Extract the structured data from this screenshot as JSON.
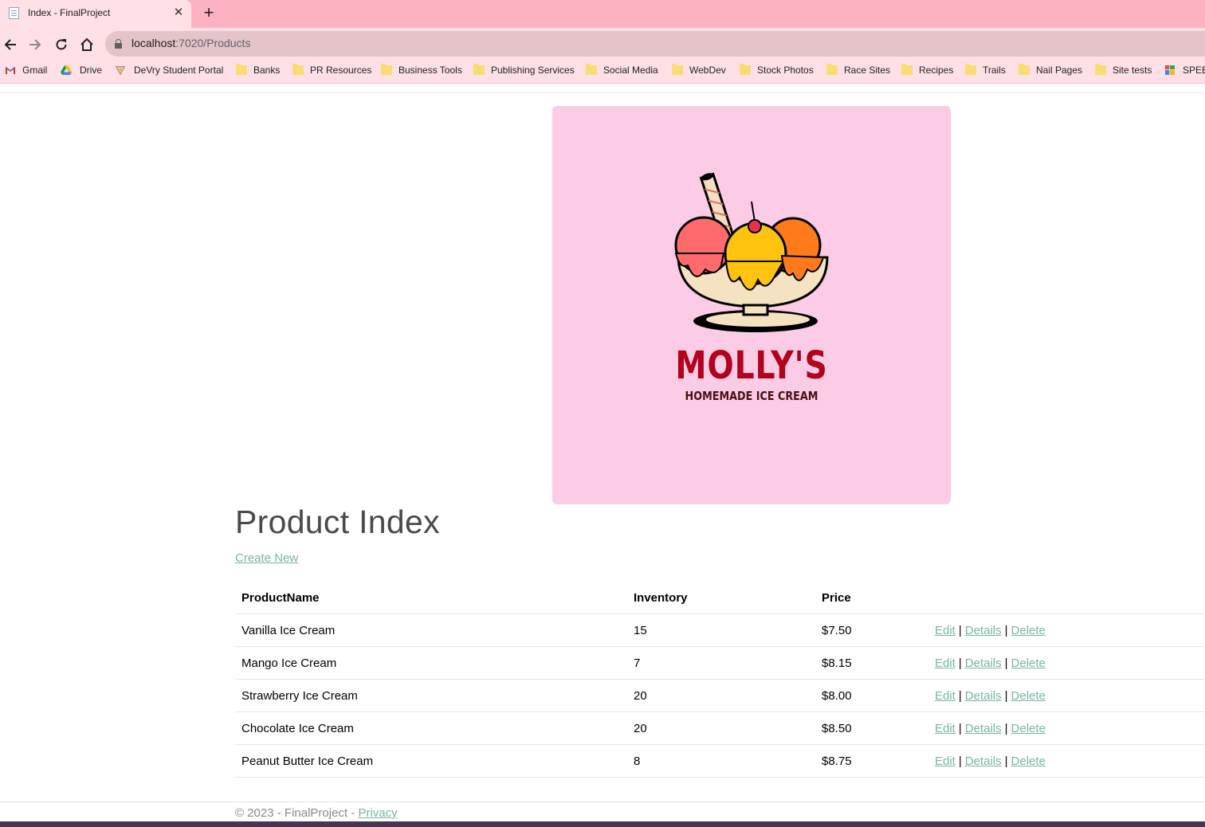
{
  "browser": {
    "tab_title": "Index - FinalProject",
    "tab_close": "✕",
    "new_tab": "+",
    "url_host": "localhost",
    "url_path": ":7020/Products",
    "bookmarks": [
      {
        "label": "Gmail",
        "icon": "gmail-icon"
      },
      {
        "label": "Drive",
        "icon": "drive-icon"
      },
      {
        "label": "DeVry Student Portal",
        "icon": "devry-icon"
      },
      {
        "label": "Banks",
        "icon": "folder-icon"
      },
      {
        "label": "PR Resources",
        "icon": "folder-icon"
      },
      {
        "label": "Business Tools",
        "icon": "folder-icon"
      },
      {
        "label": "Publishing Services",
        "icon": "folder-icon"
      },
      {
        "label": "Social Media",
        "icon": "folder-icon"
      },
      {
        "label": "WebDev",
        "icon": "folder-icon"
      },
      {
        "label": "Stock Photos",
        "icon": "folder-icon"
      },
      {
        "label": "Race Sites",
        "icon": "folder-icon"
      },
      {
        "label": "Recipes",
        "icon": "folder-icon"
      },
      {
        "label": "Trails",
        "icon": "folder-icon"
      },
      {
        "label": "Nail Pages",
        "icon": "folder-icon"
      },
      {
        "label": "Site tests",
        "icon": "folder-icon"
      },
      {
        "label": "SPEED",
        "icon": "speed-icon"
      }
    ]
  },
  "logo": {
    "title": "MOLLY'S",
    "subtitle": "HOMEMADE ICE CREAM",
    "background": "#fccce6",
    "title_color": "#b3001b"
  },
  "page": {
    "heading": "Product Index",
    "create_link": "Create New"
  },
  "table": {
    "headers": [
      "ProductName",
      "Inventory",
      "Price"
    ],
    "rows": [
      {
        "name": "Vanilla Ice Cream",
        "inventory": "15",
        "price": "$7.50"
      },
      {
        "name": "Mango Ice Cream",
        "inventory": "7",
        "price": "$8.15"
      },
      {
        "name": "Strawberry Ice Cream",
        "inventory": "20",
        "price": "$8.00"
      },
      {
        "name": "Chocolate Ice Cream",
        "inventory": "20",
        "price": "$8.50"
      },
      {
        "name": "Peanut Butter Ice Cream",
        "inventory": "8",
        "price": "$8.75"
      }
    ],
    "actions": {
      "edit": "Edit",
      "details": "Details",
      "delete": "Delete",
      "separator": "|"
    }
  },
  "footer": {
    "text": "© 2023 - FinalProject - ",
    "privacy": "Privacy"
  },
  "colors": {
    "accent_link": "#78b5a6",
    "tabstrip": "#fdb2c1",
    "toolbar": "#ffe0e6"
  }
}
